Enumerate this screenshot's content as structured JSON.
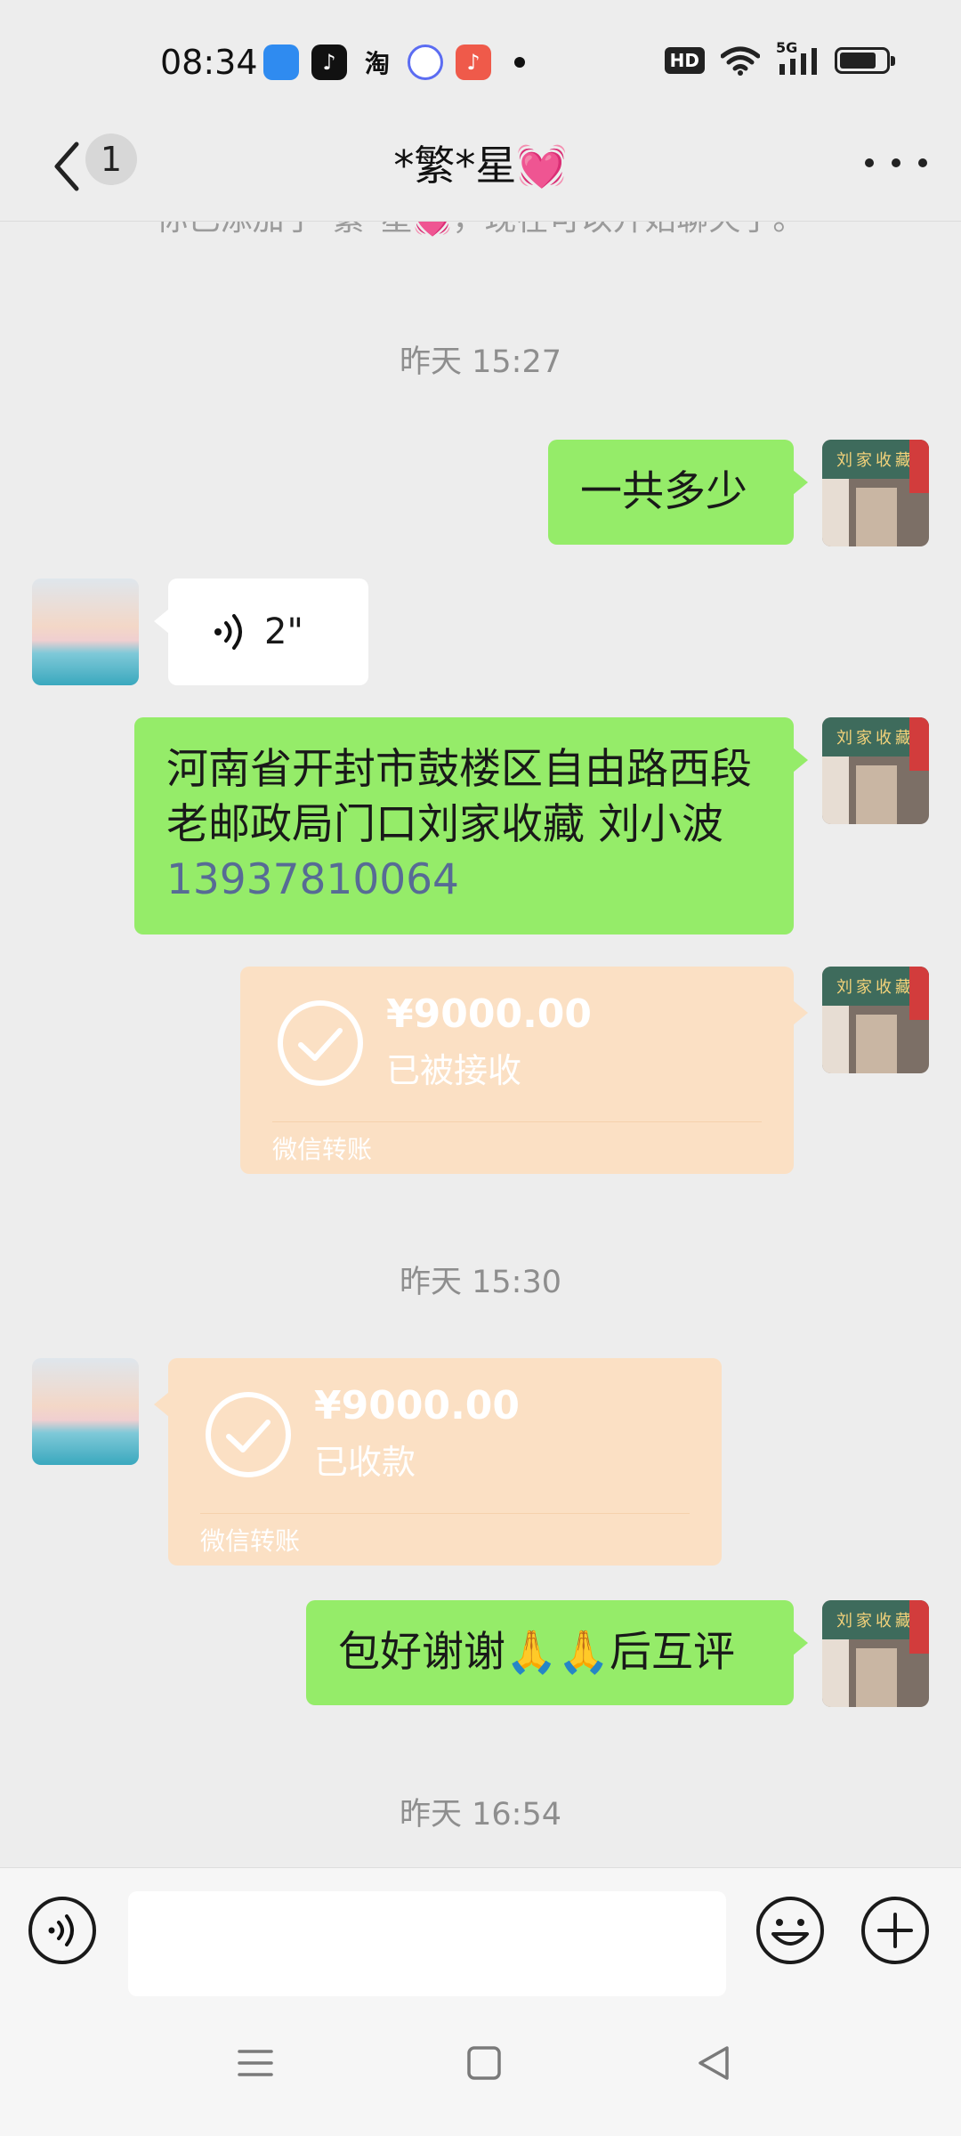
{
  "status_bar": {
    "time": "08:34",
    "apps": [
      {
        "name": "blue-app-icon",
        "color": "#2f8bf0",
        "glyph": ""
      },
      {
        "name": "tiktok-icon",
        "color": "#111111",
        "glyph": "♪"
      },
      {
        "name": "taobao-icon",
        "color": "#ededed",
        "glyph": "淘"
      },
      {
        "name": "camera-app-icon",
        "color": "#5b6cf2",
        "glyph": ""
      },
      {
        "name": "music-app-icon",
        "color": "#ef5a4a",
        "glyph": "♪"
      }
    ],
    "hd_label": "HD",
    "network_label": "5G",
    "battery_level": 0.8
  },
  "header": {
    "unread_count": "1",
    "title": "*繁*星",
    "title_heart": "💓"
  },
  "chat": {
    "system_note": "你已添加了*繁*星💓，现在可以开始聊天了。",
    "timestamps": [
      "昨天 15:27",
      "昨天 15:30",
      "昨天 16:54"
    ],
    "messages": {
      "m1": "一共多少",
      "voice_duration": "2\"",
      "address_text": "河南省开封市鼓楼区自由路西段老邮政局门口刘家收藏 刘小波 ",
      "address_phone": "13937810064",
      "m_final_a": "包好谢谢",
      "m_final_emoji": "🙏🙏",
      "m_final_b": "后互评"
    },
    "transfer_sent": {
      "amount": "¥9000.00",
      "status": "已被接收",
      "footer": "微信转账"
    },
    "transfer_received": {
      "amount": "¥9000.00",
      "status": "已收款",
      "footer": "微信转账"
    },
    "shop_sign": "刘家收藏"
  },
  "input": {
    "placeholder": ""
  },
  "colors": {
    "bubble_out": "#95ec69",
    "bubble_in": "#ffffff",
    "transfer": "#fbe0c4",
    "link": "#576b95",
    "background": "#ededed"
  }
}
